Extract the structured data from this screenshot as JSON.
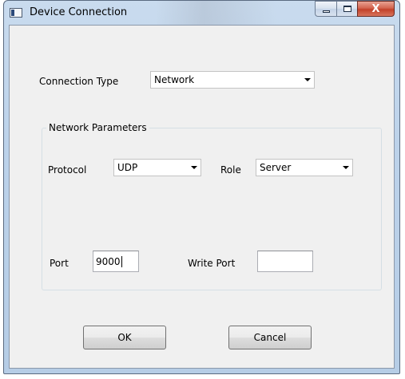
{
  "window": {
    "title": "Device Connection",
    "close_glyph": "X",
    "minimize_icon": "minimize-icon",
    "maximize_icon": "maximize-icon",
    "close_icon": "close-icon",
    "app_icon": "app-window-icon"
  },
  "connection": {
    "label": "Connection Type",
    "selected": "Network"
  },
  "network_params": {
    "group_title": "Network Parameters",
    "protocol_label": "Protocol",
    "protocol_selected": "UDP",
    "role_label": "Role",
    "role_selected": "Server",
    "port_label": "Port",
    "port_value": "9000",
    "write_port_label": "Write Port",
    "write_port_value": ""
  },
  "buttons": {
    "ok": "OK",
    "cancel": "Cancel"
  }
}
